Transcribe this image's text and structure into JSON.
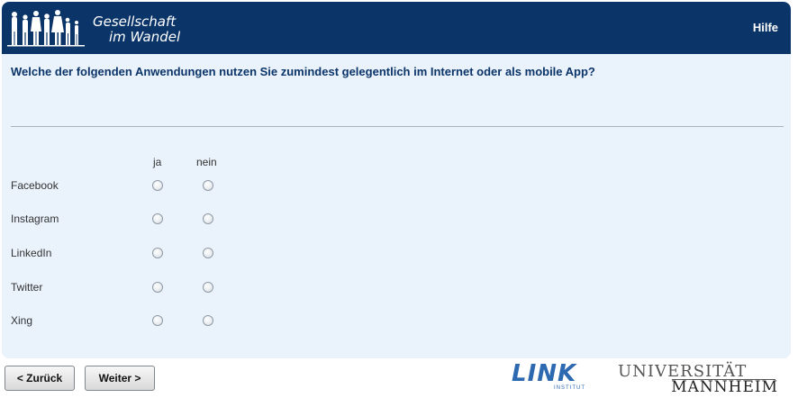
{
  "header": {
    "logo_line1": "Gesellschaft",
    "logo_line2": "im Wandel",
    "help_label": "Hilfe"
  },
  "question": "Welche der folgenden Anwendungen nutzen Sie zumindest gelegentlich im Internet oder als mobile App?",
  "columns": [
    "ja",
    "nein"
  ],
  "rows": [
    {
      "label": "Facebook"
    },
    {
      "label": "Instagram"
    },
    {
      "label": "LinkedIn"
    },
    {
      "label": "Twitter"
    },
    {
      "label": "Xing"
    }
  ],
  "nav": {
    "back_label": "< Zurück",
    "next_label": "Weiter >"
  },
  "footer": {
    "link_word": "LINK",
    "link_sub": "INSTITUT",
    "uni_line1": "UNIVERSITÄT",
    "uni_line2": "MANNHEIM"
  }
}
